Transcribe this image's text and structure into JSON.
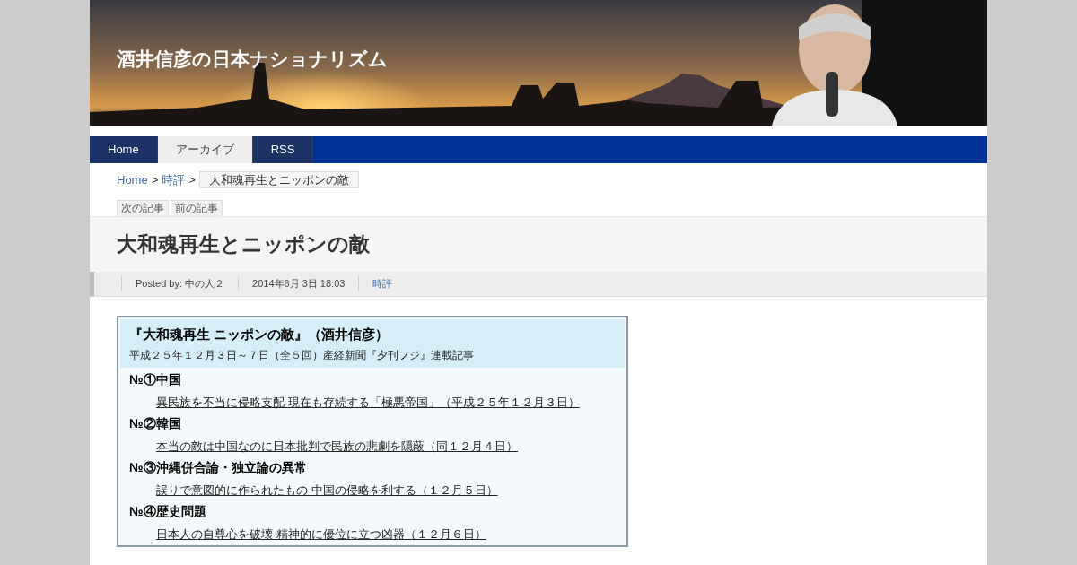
{
  "site_title": "酒井信彦の日本ナショナリズム",
  "nav": [
    {
      "label": "Home",
      "selected": false
    },
    {
      "label": "アーカイブ",
      "selected": true
    },
    {
      "label": "RSS",
      "selected": false
    }
  ],
  "breadcrumb": {
    "links": [
      "Home",
      "時評"
    ],
    "separator": ">",
    "current": "大和魂再生とニッポンの敵"
  },
  "post_nav": [
    "次の記事",
    "前の記事"
  ],
  "article": {
    "title": "大和魂再生とニッポンの敵",
    "meta": {
      "posted_by": "Posted by: 中の人２",
      "date": "2014年6月 3日 18:03",
      "category": "時評"
    },
    "box": {
      "title": "『大和魂再生 ニッポンの敵』（酒井信彦）",
      "subtitle": "平成２５年１２月３日～７日（全５回）産経新聞『夕刊フジ』連載記事",
      "sections": [
        {
          "heading": "№①中国",
          "link": "異民族を不当に侵略支配 現在も存続する「極悪帝国」（平成２５年１２月３日）"
        },
        {
          "heading": "№②韓国",
          "link": "本当の敵は中国なのに日本批判で民族の悲劇を隠蔽（同１２月４日）"
        },
        {
          "heading": "№③沖縄併合論・独立論の異常",
          "link": "誤りで意図的に作られたもの 中国の侵略を利する（１２月５日）"
        },
        {
          "heading": "№④歴史問題",
          "link": "日本人の自尊心を破壊 精神的に優位に立つ凶器（１２月６日）"
        }
      ]
    }
  }
}
